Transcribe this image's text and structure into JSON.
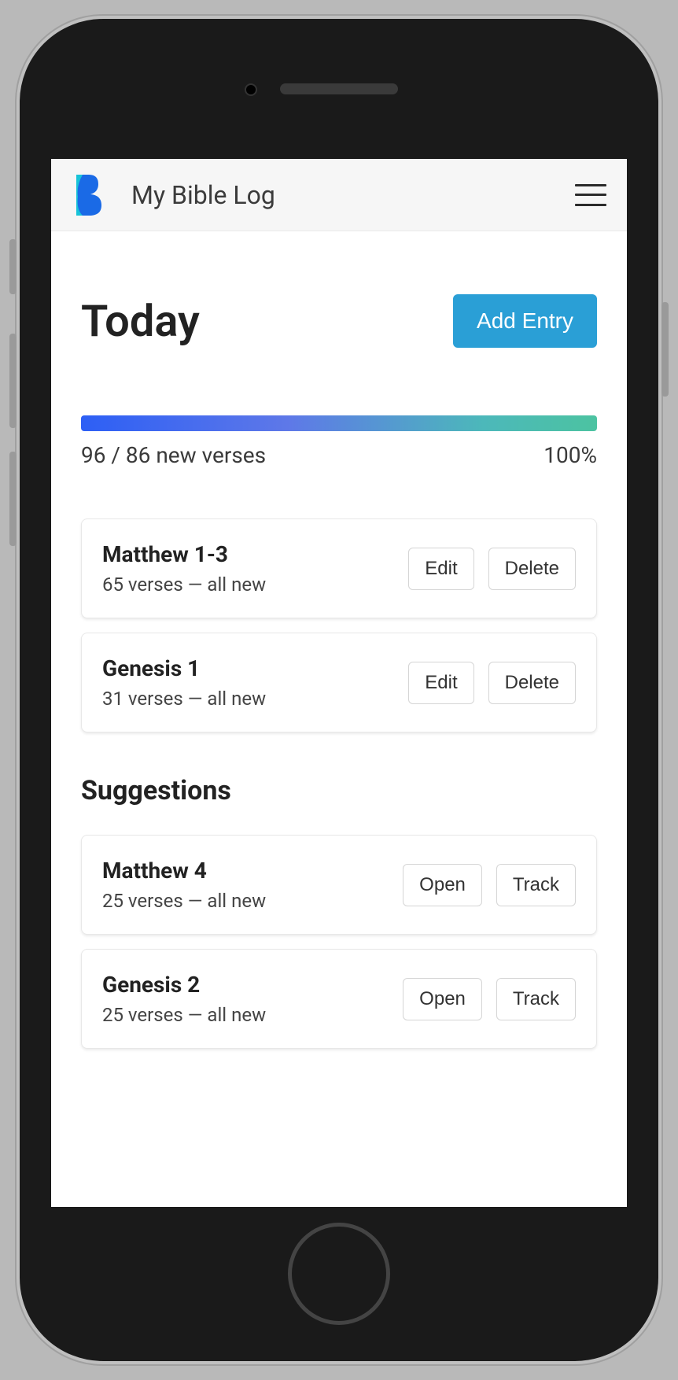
{
  "navbar": {
    "brand": "My Bible Log"
  },
  "page": {
    "title": "Today",
    "add_entry_label": "Add Entry"
  },
  "progress": {
    "verses_label": "96 / 86 new verses",
    "percent_label": "100%",
    "percent_value": 100
  },
  "entries": [
    {
      "title": "Matthew 1-3",
      "subtitle": "65 verses — all new",
      "edit_label": "Edit",
      "delete_label": "Delete"
    },
    {
      "title": "Genesis 1",
      "subtitle": "31 verses — all new",
      "edit_label": "Edit",
      "delete_label": "Delete"
    }
  ],
  "suggestions_heading": "Suggestions",
  "suggestions": [
    {
      "title": "Matthew 4",
      "subtitle": "25 verses — all new",
      "open_label": "Open",
      "track_label": "Track"
    },
    {
      "title": "Genesis 2",
      "subtitle": "25 verses — all new",
      "open_label": "Open",
      "track_label": "Track"
    }
  ],
  "colors": {
    "accent": "#2a9fd6",
    "gradient_start": "#2d5ff5",
    "gradient_end": "#4cc3a1"
  }
}
